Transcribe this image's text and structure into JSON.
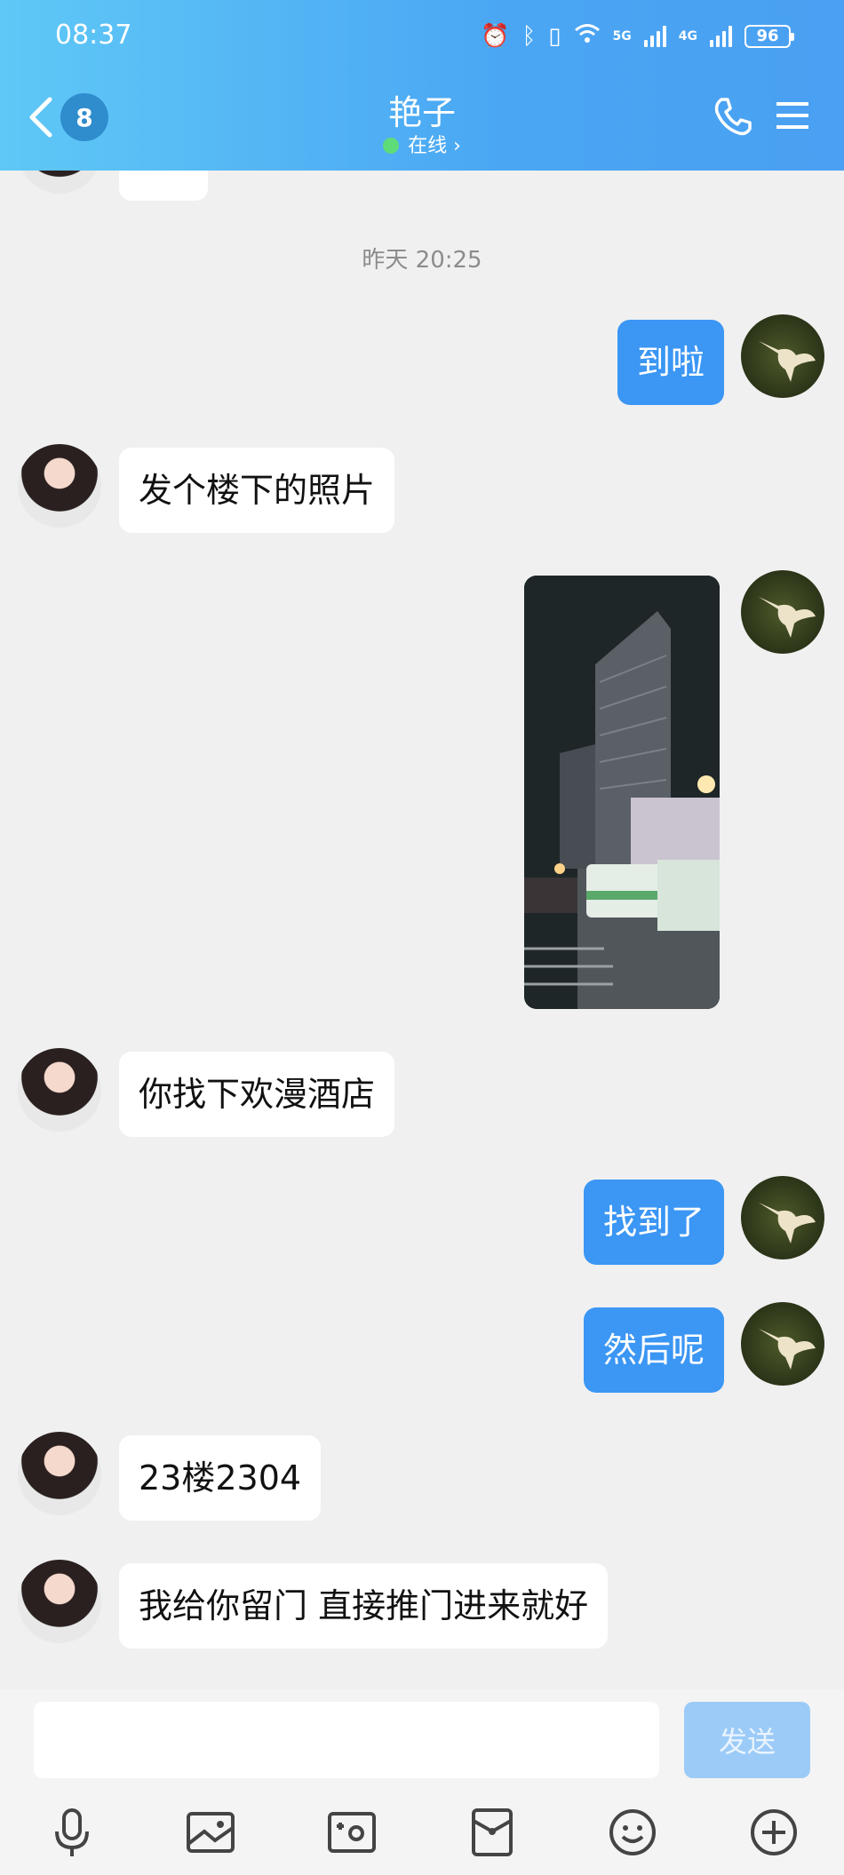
{
  "status_bar": {
    "time": "08:37",
    "net1": "5G",
    "net2": "4G",
    "battery": "96"
  },
  "header": {
    "unread_count": "8",
    "contact_name": "艳子",
    "online_status": "在线 ›"
  },
  "chat": {
    "timestamp": "昨天 20:25",
    "messages": [
      {
        "side": "out",
        "text": "到啦"
      },
      {
        "side": "in",
        "text": "发个楼下的照片"
      },
      {
        "side": "out",
        "type": "image"
      },
      {
        "side": "in",
        "text": "你找下欢漫酒店"
      },
      {
        "side": "out",
        "text": "找到了"
      },
      {
        "side": "out",
        "text": "然后呢"
      },
      {
        "side": "in",
        "text": "23楼2304"
      },
      {
        "side": "in",
        "text": "我给你留门 直接推门进来就好"
      }
    ]
  },
  "input": {
    "value": "",
    "send_label": "发送"
  },
  "toolbar": [
    "mic-icon",
    "image-icon",
    "camera-icon",
    "red-packet-icon",
    "emoji-icon",
    "plus-icon"
  ],
  "colors": {
    "header_start": "#5fc8f6",
    "header_end": "#4aa0f2",
    "outgoing_bubble": "#3b96f4",
    "send_disabled": "#9ccbf8"
  }
}
